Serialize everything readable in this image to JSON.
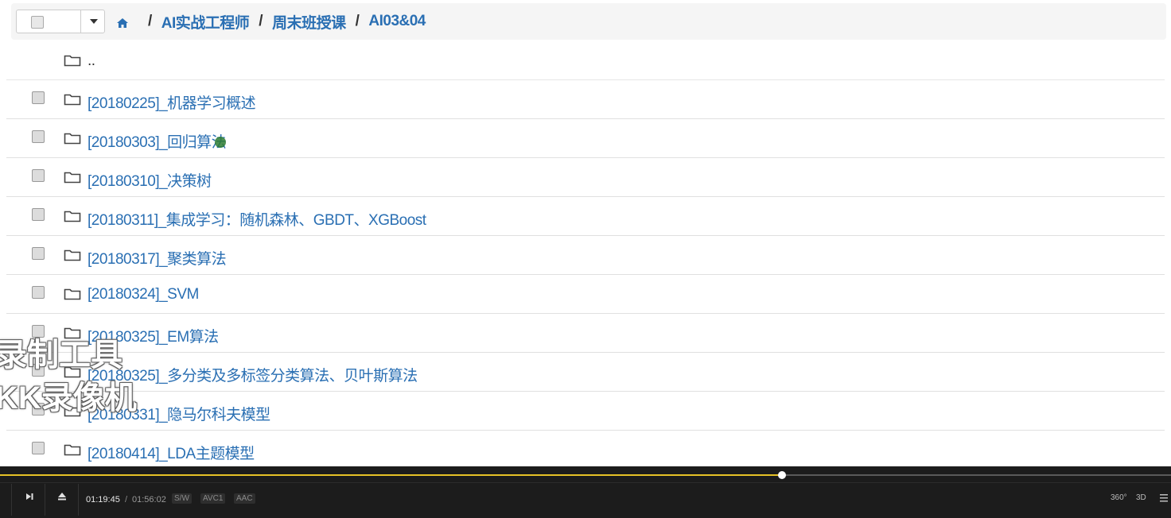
{
  "breadcrumb": {
    "items": [
      "AI实战工程师",
      "周末班授课",
      "AI03&04"
    ],
    "separator": "/"
  },
  "files": {
    "parent": "..",
    "items": [
      "[20180225]_机器学习概述",
      "[20180303]_回归算法",
      "[20180310]_决策树",
      "[20180311]_集成学习：随机森林、GBDT、XGBoost",
      "[20180317]_聚类算法",
      "[20180324]_SVM",
      "[20180325]_EM算法",
      "[20180325]_多分类及多标签分类算法、贝叶斯算法",
      "[20180331]_隐马尔科夫模型",
      "[20180414]_LDA主题模型"
    ]
  },
  "watermark": {
    "line1": "录制工具",
    "line2": "KK录像机"
  },
  "player": {
    "current_time": "01:19:45",
    "time_separator": "/",
    "total_time": "01:56:02",
    "progress_fraction": 0.668,
    "badges": [
      "S/W",
      "AVC1",
      "AAC"
    ],
    "right_controls": [
      "360°",
      "3D"
    ],
    "accent_color": "#e6c227"
  },
  "colors": {
    "link": "#2a6fb3",
    "player_bg": "#1c1c1c"
  },
  "icons": {
    "home": "home-icon",
    "folder": "folder-icon",
    "play_next": "next-icon",
    "eject": "eject-icon",
    "menu": "menu-icon"
  }
}
